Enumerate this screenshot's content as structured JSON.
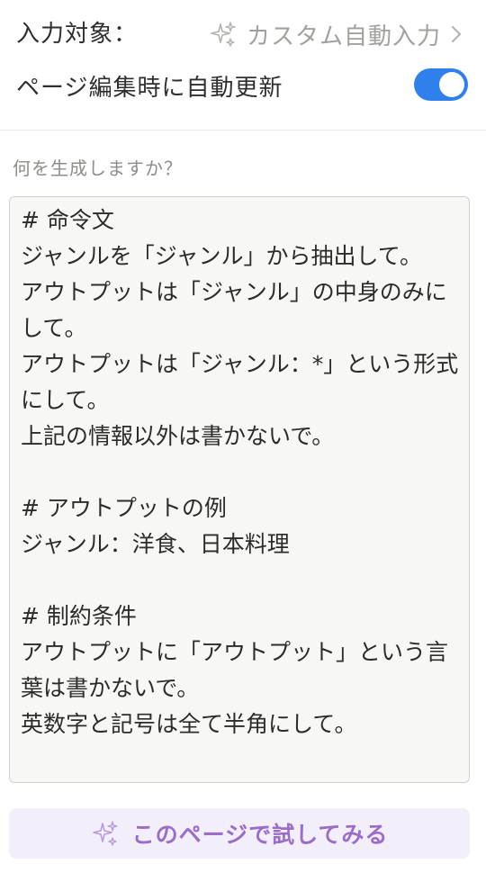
{
  "input_target": {
    "label": "入力対象：",
    "value": "カスタム自動入力",
    "icon": "sparkle-icon"
  },
  "auto_update": {
    "label": "ページ編集時に自動更新",
    "enabled": true,
    "color": "#2f80ed"
  },
  "prompt": {
    "label": "何を生成しますか？",
    "text": "# 命令文\nジャンルを「ジャンル」から抽出して。\nアウトプットは「ジャンル」の中身のみにして。\nアウトプットは「ジャンル：*」という形式にして。\n上記の情報以外は書かないで。\n\n# アウトプットの例\nジャンル：洋食、日本料理\n\n# 制約条件\nアウトプットに「アウトプット」という言葉は書かないで。\n英数字と記号は全て半角にして。"
  },
  "try_button": {
    "label": "このページで試してみる",
    "icon": "sparkle-icon",
    "color": "#9a6dc9"
  }
}
